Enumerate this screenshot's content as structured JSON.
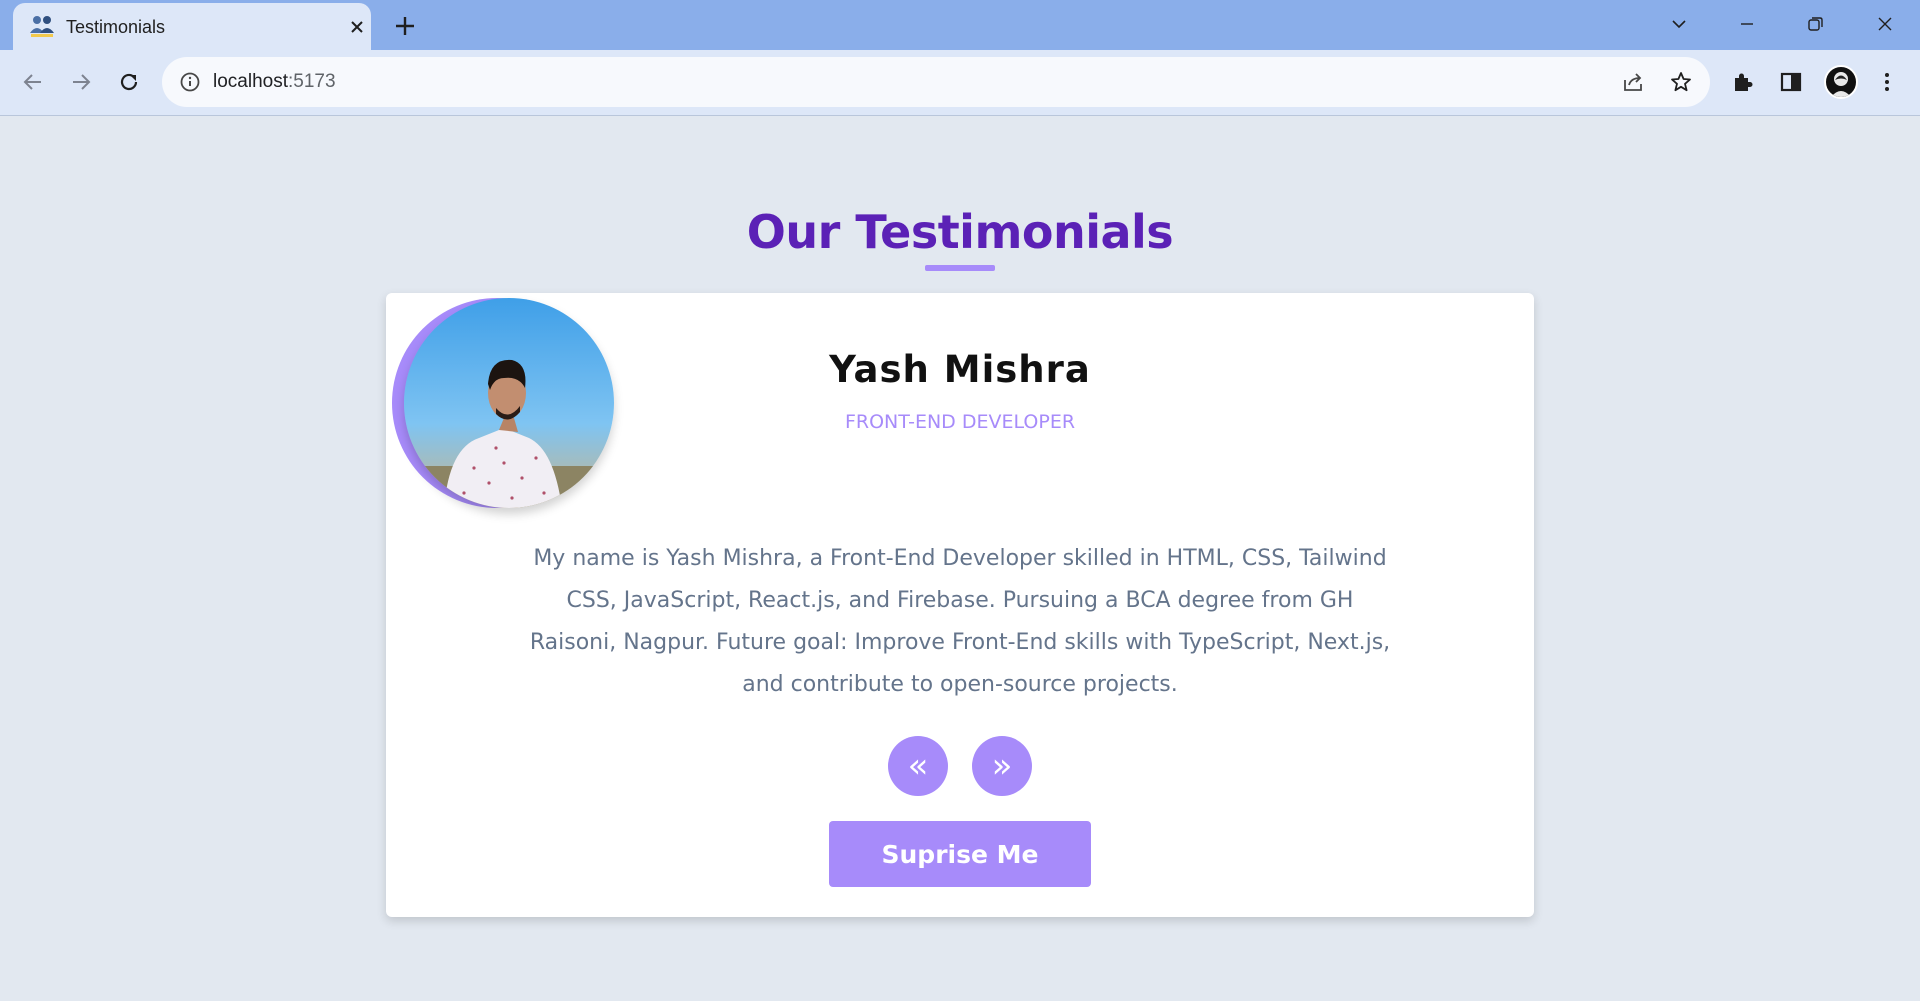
{
  "browser": {
    "tab_title": "Testimonials",
    "url_host": "localhost",
    "url_port": ":5173",
    "icons": [
      "people-favicon",
      "close-icon",
      "plus-icon",
      "chevron-down-icon",
      "minimize-icon",
      "restore-icon",
      "window-close-icon",
      "back-icon",
      "forward-icon",
      "reload-icon",
      "info-icon",
      "share-icon",
      "star-icon",
      "extensions-icon",
      "side-panel-icon",
      "avatar",
      "menu-icon"
    ]
  },
  "page": {
    "heading": "Our Testimonials",
    "accent_color": "#a78bfa",
    "heading_color": "#5b21b6",
    "background_color": "#e2e8f0"
  },
  "testimonial": {
    "name": "Yash Mishra",
    "role": "FRONT-END DEVELOPER",
    "bio": "My name is Yash Mishra, a Front-End Developer skilled in HTML, CSS, Tailwind CSS, JavaScript, React.js, and Firebase. Pursuing a BCA degree from GH Raisoni, Nagpur. Future goal: Improve Front-End skills with TypeScript, Next.js, and contribute to open-source projects."
  },
  "controls": {
    "prev_label": "«",
    "next_label": "»",
    "surprise_label": "Suprise Me"
  }
}
